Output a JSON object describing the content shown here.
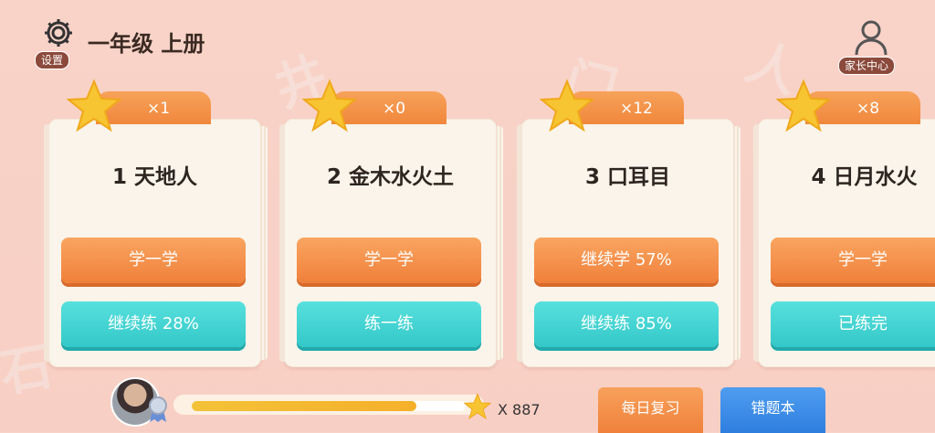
{
  "header": {
    "settings_label": "设置",
    "title": "一年级 上册",
    "parent_center_label": "家长中心"
  },
  "lessons": [
    {
      "stars": "×1",
      "title": "1 天地人",
      "learn_label": "学一学",
      "practice_label": "继续练 28%"
    },
    {
      "stars": "×0",
      "title": "2 金木水火土",
      "learn_label": "学一学",
      "practice_label": "练一练"
    },
    {
      "stars": "×12",
      "title": "3 口耳目",
      "learn_label": "继续学 57%",
      "practice_label": "继续练 85%"
    },
    {
      "stars": "×8",
      "title": "4 日月水火",
      "learn_label": "学一学",
      "practice_label": "已练完"
    }
  ],
  "footer": {
    "progress_fraction": 0.82,
    "star_count": "X 887",
    "daily_review_label": "每日复习",
    "mistake_book_label": "错题本"
  },
  "colors": {
    "background": "#f9d3c8",
    "orange": "#f0873c",
    "teal": "#33c8c8",
    "blue": "#2e7ee0",
    "star": "#f7c531"
  },
  "icons": [
    "gear-icon",
    "person-icon",
    "star-icon",
    "medal-icon"
  ]
}
